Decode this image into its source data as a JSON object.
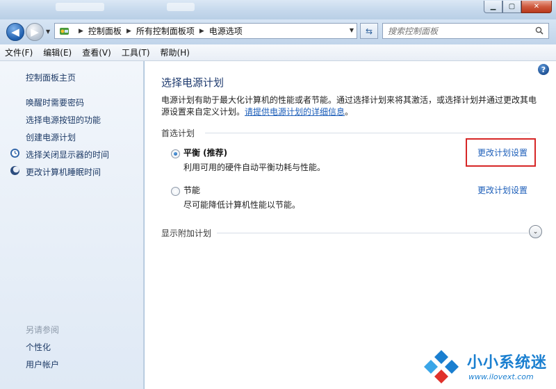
{
  "window": {
    "minimize_glyph": "▁",
    "maximize_glyph": "▢",
    "close_glyph": "✕"
  },
  "nav": {
    "back_glyph": "◀",
    "forward_glyph": "▶",
    "breadcrumb": [
      "控制面板",
      "所有控制面板项",
      "电源选项"
    ],
    "search_placeholder": "搜索控制面板"
  },
  "menu": [
    "文件(F)",
    "编辑(E)",
    "查看(V)",
    "工具(T)",
    "帮助(H)"
  ],
  "sidebar": {
    "home": "控制面板主页",
    "items": [
      {
        "label": "唤醒时需要密码",
        "icon": ""
      },
      {
        "label": "选择电源按钮的功能",
        "icon": ""
      },
      {
        "label": "创建电源计划",
        "icon": ""
      },
      {
        "label": "选择关闭显示器的时间",
        "icon": "monitor-clock-icon"
      },
      {
        "label": "更改计算机睡眠时间",
        "icon": "moon-icon"
      }
    ],
    "see_also": "另请参阅",
    "see_also_items": [
      "个性化",
      "用户帐户"
    ]
  },
  "main": {
    "title": "选择电源计划",
    "description": "电源计划有助于最大化计算机的性能或者节能。通过选择计划来将其激活，或选择计划并通过更改其电源设置来自定义计划。",
    "description_link": "请提供电源计划的详细信息",
    "description_end": "。",
    "preferred_header": "首选计划",
    "plans": [
      {
        "name": "平衡 (推荐)",
        "description": "利用可用的硬件自动平衡功耗与性能。",
        "selected": true,
        "link": "更改计划设置"
      },
      {
        "name": "节能",
        "description": "尽可能降低计算机性能以节能。",
        "selected": false,
        "link": "更改计划设置"
      }
    ],
    "additional_header": "显示附加计划",
    "help_glyph": "?",
    "expand_glyph": "⌄"
  },
  "watermark": {
    "text": "小小系统迷",
    "url": "www.ilovext.com"
  },
  "colors": {
    "link": "#1c5eb9",
    "highlight_box": "#d62626",
    "title": "#1e3a6e"
  }
}
